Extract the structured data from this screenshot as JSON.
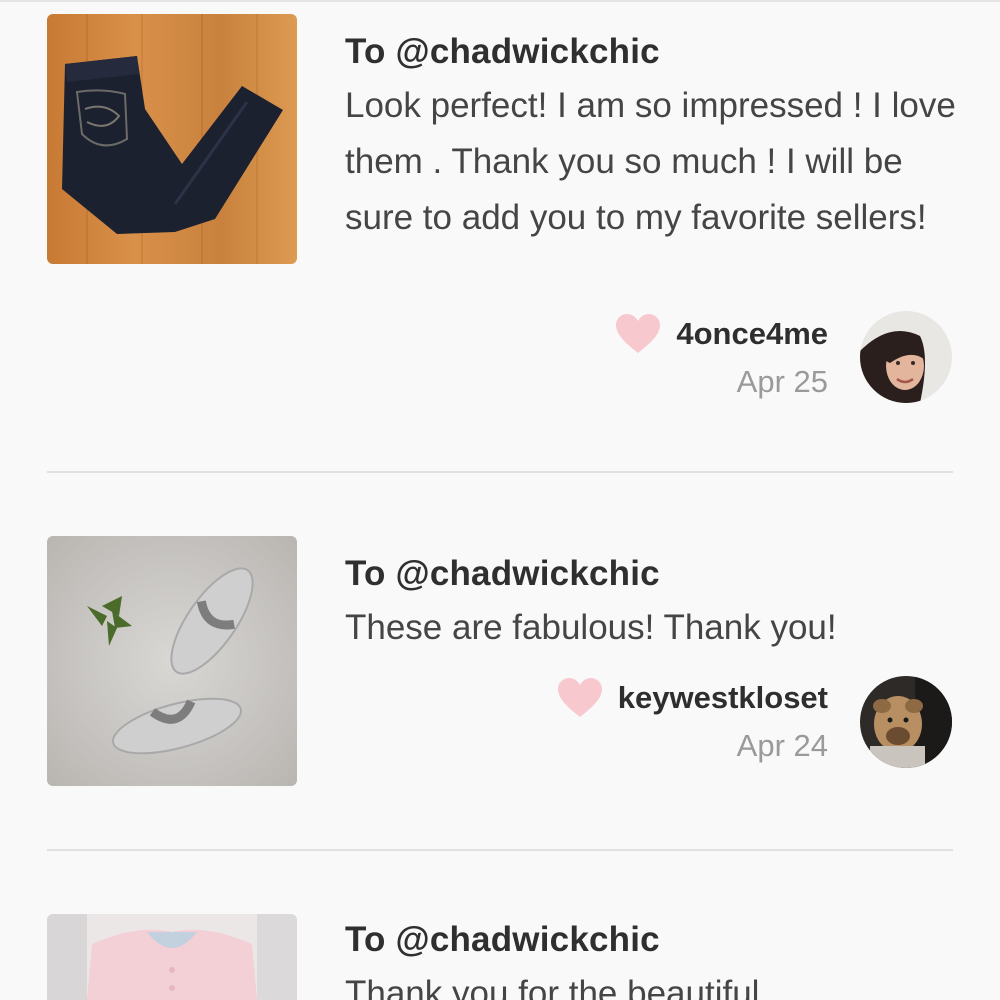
{
  "reviews": [
    {
      "to": "To @chadwickchic",
      "message": "Look perfect! I am so impressed ! I love them . Thank you so much ! I will be sure to add you to my favorite sellers!",
      "username": "4once4me",
      "date": "Apr 25",
      "thumbnail": "dark-jeans-photo",
      "avatar": "woman-avatar"
    },
    {
      "to": "To @chadwickchic",
      "message": "These are fabulous! Thank you!",
      "username": "keywestkloset",
      "date": "Apr 24",
      "thumbnail": "silver-sandals-photo",
      "avatar": "dog-avatar"
    },
    {
      "to": "To @chadwickchic",
      "message": "Thank you for the beautiful",
      "thumbnail": "pink-cardigan-photo"
    }
  ],
  "colors": {
    "background": "#faf9f9",
    "heart": "#f7c9cf",
    "date": "#9a9a9a",
    "divider": "#e2e0e0"
  }
}
